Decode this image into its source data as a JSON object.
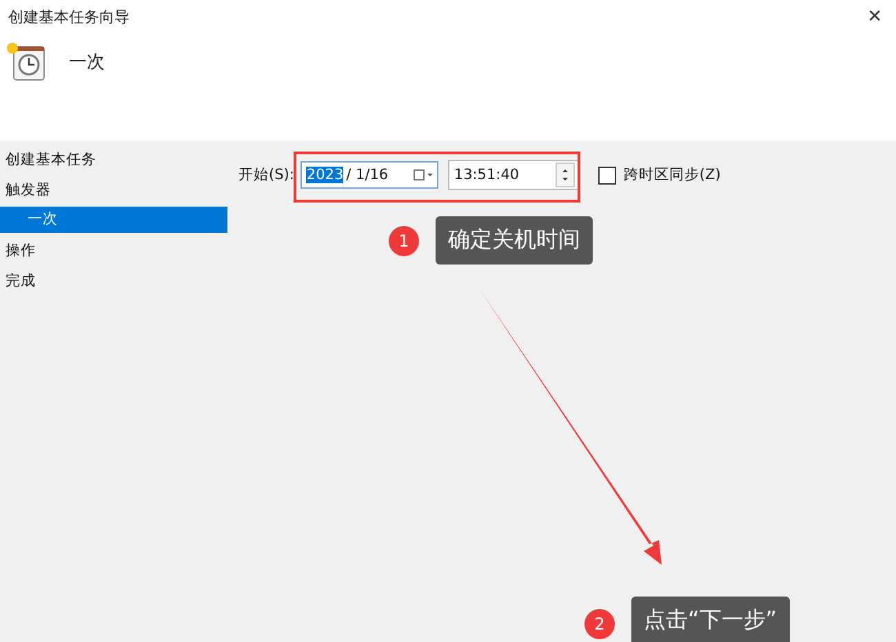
{
  "window": {
    "title": "创建基本任务向导",
    "close": "✕"
  },
  "header": {
    "title": "一次"
  },
  "sidebar": {
    "items": [
      {
        "label": "创建基本任务",
        "selected": false
      },
      {
        "label": "触发器",
        "selected": false,
        "children": [
          {
            "label": "一次",
            "selected": true
          }
        ]
      },
      {
        "label": "操作",
        "selected": false
      },
      {
        "label": "完成",
        "selected": false
      }
    ]
  },
  "start": {
    "label": "开始(S):",
    "year": "2023",
    "date_rest": "/  1/16",
    "time": "13:51:40",
    "sync": {
      "label": "跨时区同步(Z)",
      "checked": false
    }
  },
  "annotations": [
    {
      "number": "1",
      "text": "确定关机时间"
    },
    {
      "number": "2",
      "text": "点击“下一步”"
    }
  ]
}
